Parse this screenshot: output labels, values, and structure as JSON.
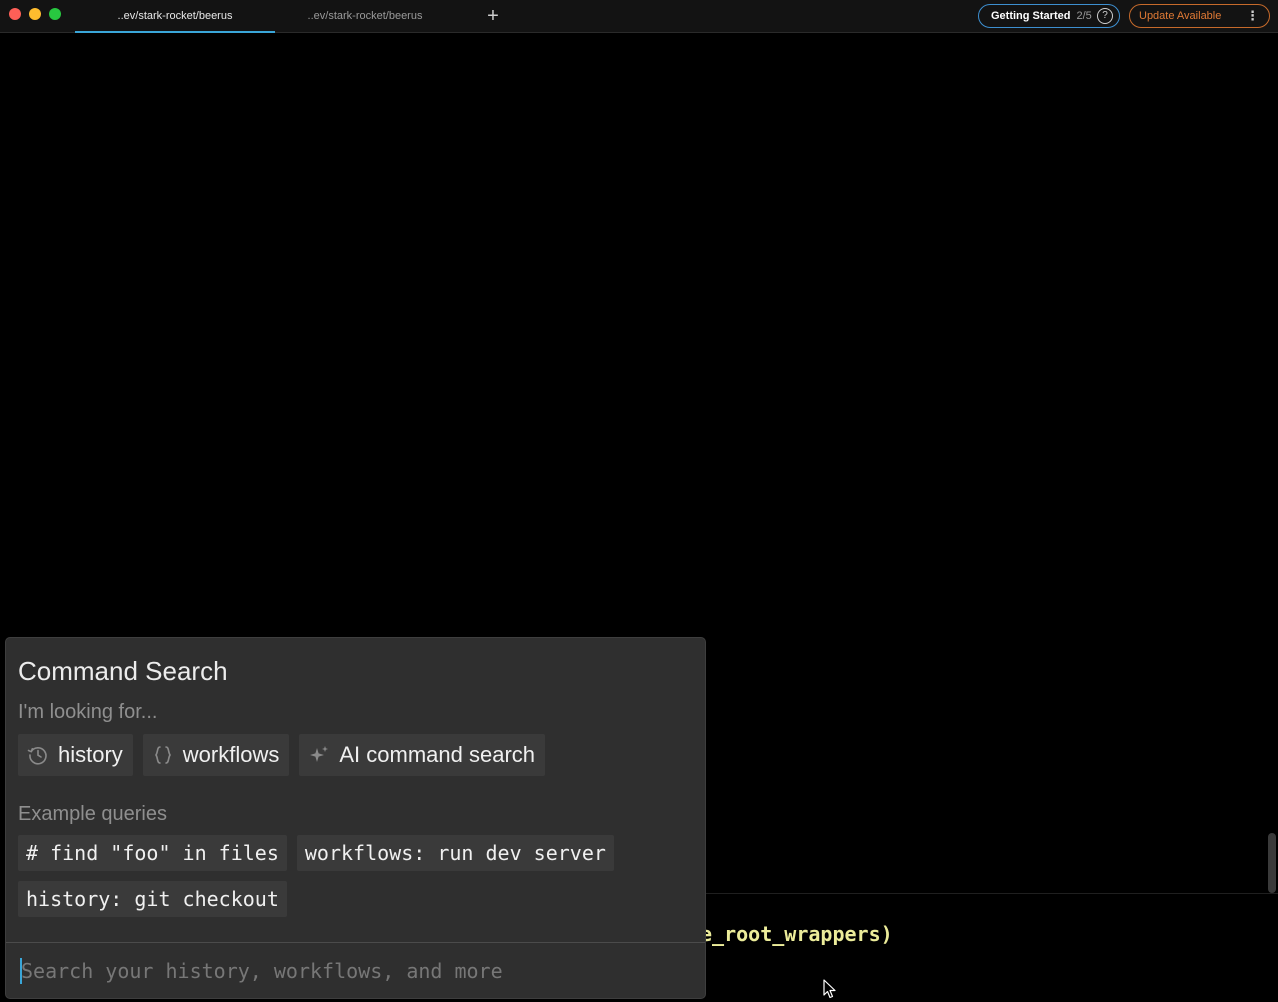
{
  "titlebar": {
    "tabs": [
      {
        "label": "..ev/stark-rocket/beerus",
        "active": true
      },
      {
        "label": "..ev/stark-rocket/beerus",
        "active": false
      }
    ],
    "new_tab_glyph": "+",
    "getting_started": {
      "label": "Getting Started",
      "count": "2/5",
      "help_glyph": "?"
    },
    "update": {
      "label": "Update Available",
      "menu_glyph": "⋮"
    }
  },
  "terminal": {
    "visible_text": "e_root_wrappers)"
  },
  "command_search": {
    "title": "Command Search",
    "looking_for_label": "I'm looking for...",
    "filters": [
      {
        "label": "history",
        "icon": "clock-history-icon"
      },
      {
        "label": "workflows",
        "icon": "braces-icon"
      },
      {
        "label": "AI command search",
        "icon": "sparkle-icon"
      }
    ],
    "examples_label": "Example queries",
    "examples": [
      "# find \"foo\" in files",
      "workflows: run dev server",
      "history: git checkout"
    ],
    "input": {
      "value": "",
      "placeholder": "Search your history, workflows, and more"
    }
  },
  "colors": {
    "accent": "#3aa6d8",
    "getting_started_border": "#3d8fd0",
    "update_orange": "#e07a35",
    "panel_bg": "#2f2f2f",
    "chip_bg": "#3a3a3a"
  }
}
